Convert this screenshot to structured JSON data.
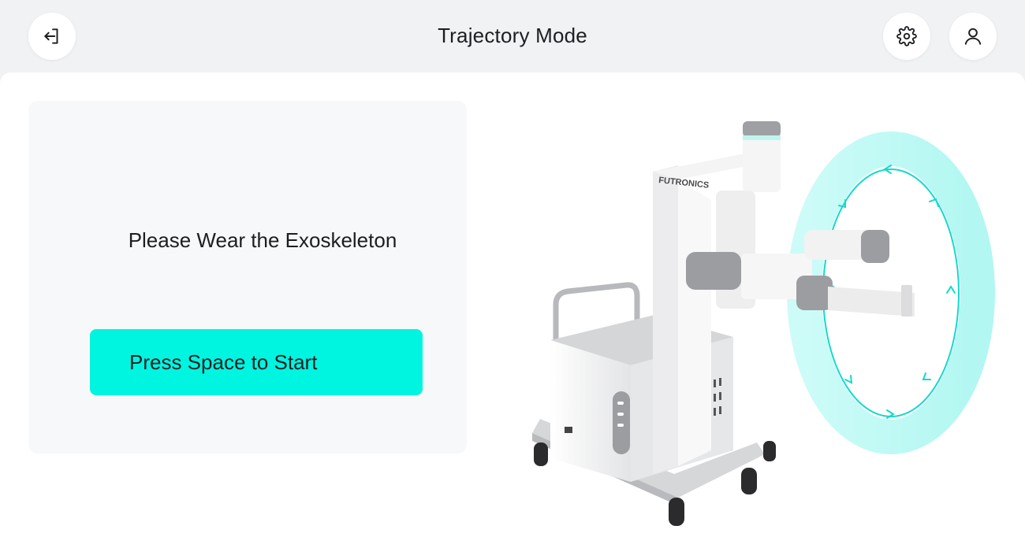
{
  "header": {
    "title": "Trajectory Mode",
    "back_icon": "exit-icon",
    "settings_icon": "gear-icon",
    "user_icon": "user-icon"
  },
  "card": {
    "prompt": "Please Wear the Exoskeleton",
    "start_button_label": "Press Space to Start"
  },
  "illustration": {
    "brand_label": "FUTRONICS",
    "trajectory_color": "#14d9cc"
  },
  "colors": {
    "accent": "#00f5e1",
    "background": "#f1f2f4",
    "card_background": "#f7f8fa"
  }
}
